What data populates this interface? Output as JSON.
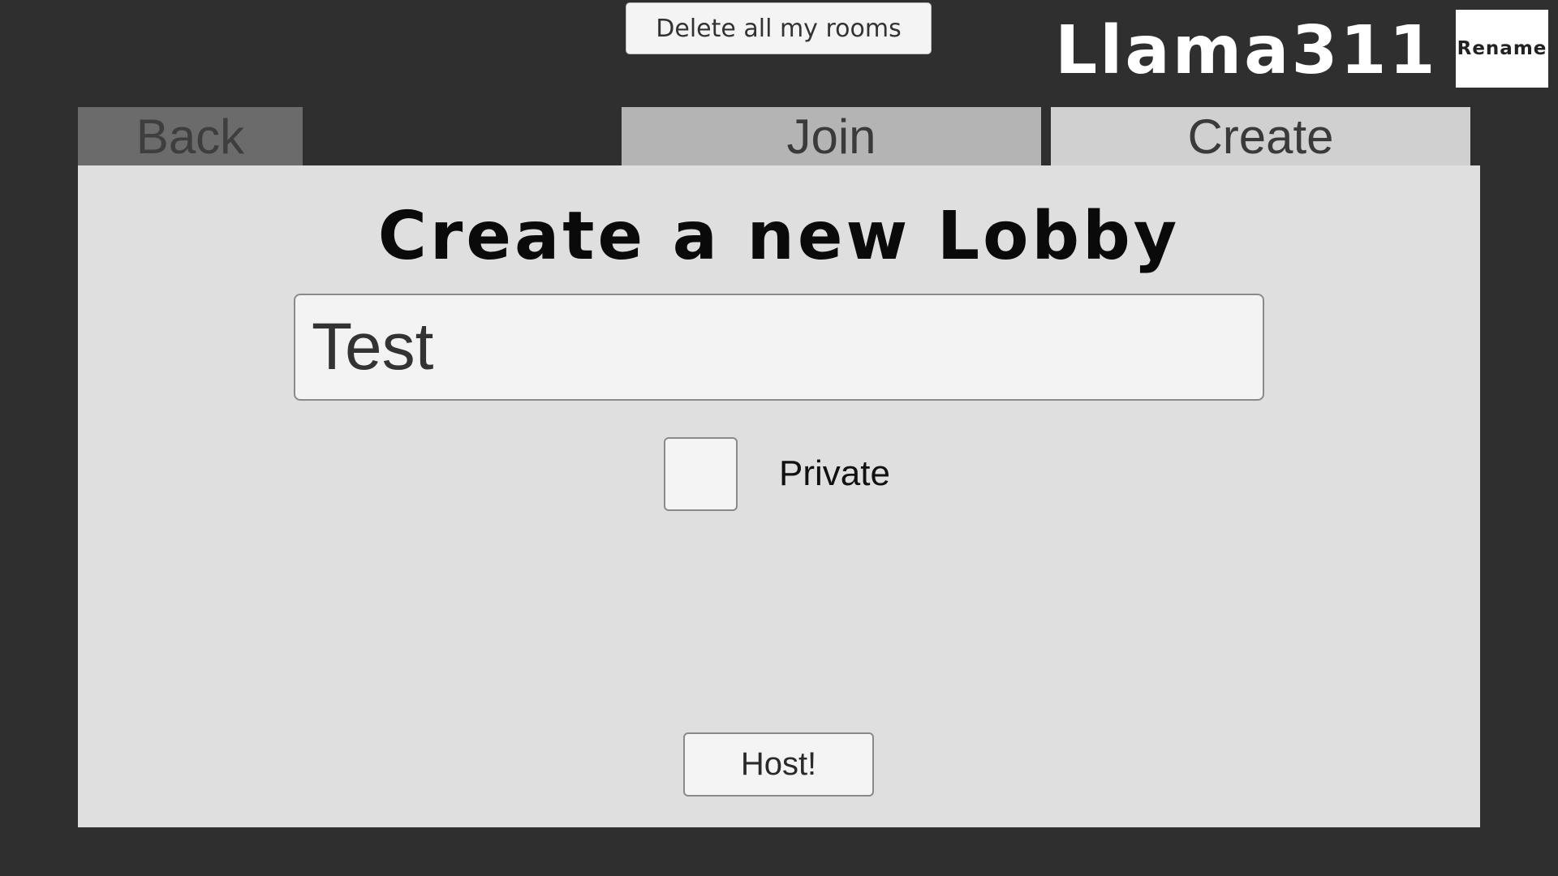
{
  "header": {
    "delete_button_label": "Delete all my rooms",
    "username": "Llama311",
    "rename_button_label": "Rename"
  },
  "tabs": [
    {
      "label": "Back",
      "active": false
    },
    {
      "label": "Join",
      "active": false
    },
    {
      "label": "Create",
      "active": true
    }
  ],
  "create_panel": {
    "title": "Create a new Lobby",
    "lobby_name_value": "Test",
    "private_label": "Private",
    "private_checked": false,
    "host_button_label": "Host!"
  },
  "colors": {
    "background": "#2f2f2f",
    "panel": "#dfdfdf",
    "tab_back": "#6b6b6b",
    "tab_join": "#b4b4b4",
    "tab_create": "#d0d0d0"
  }
}
